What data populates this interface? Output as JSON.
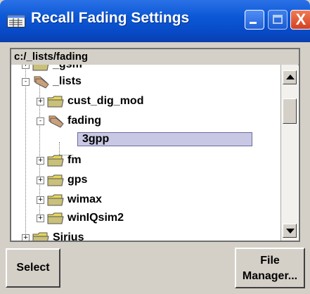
{
  "window": {
    "title": "Recall Fading Settings",
    "close_symbol": "X"
  },
  "path": "c:/_lists/fading",
  "tree": {
    "rows": [
      {
        "label": "_gsm",
        "level": 1,
        "kind": "folder",
        "expander": "+"
      },
      {
        "label": "_lists",
        "level": 1,
        "kind": "folder-open",
        "expander": "-"
      },
      {
        "label": "cust_dig_mod",
        "level": 2,
        "kind": "folder",
        "expander": "+"
      },
      {
        "label": "fading",
        "level": 2,
        "kind": "folder-open",
        "expander": "-"
      },
      {
        "label": "3gpp",
        "level": 3,
        "kind": "file",
        "selected": true
      },
      {
        "label": "fm",
        "level": 2,
        "kind": "folder",
        "expander": "+"
      },
      {
        "label": "gps",
        "level": 2,
        "kind": "folder",
        "expander": "+"
      },
      {
        "label": "wimax",
        "level": 2,
        "kind": "folder",
        "expander": "+"
      },
      {
        "label": "winIQsim2",
        "level": 2,
        "kind": "folder",
        "expander": "+"
      },
      {
        "label": "Sirius",
        "level": 1,
        "kind": "folder",
        "expander": "+"
      }
    ]
  },
  "buttons": {
    "select": "Select",
    "file_manager_line1": "File",
    "file_manager_line2": "Manager..."
  },
  "icons": {
    "app": "window-icon",
    "folder": "folder-icon",
    "folder_open": "folder-open-icon"
  },
  "colors": {
    "title_bar": "#0b58d6",
    "selection": "#c9c8e4",
    "close_button": "#d6401f"
  }
}
